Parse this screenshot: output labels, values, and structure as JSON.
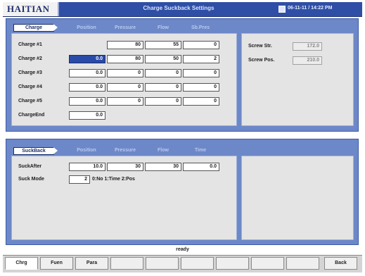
{
  "header": {
    "logo_text": "HAITIAN",
    "title": "Charge Suckback Settings",
    "datetime": "06-11-11 / 14:22 PM"
  },
  "charge": {
    "tab_label": "Charge",
    "columns": [
      "Position",
      "Pressure",
      "Flow",
      "Sb.Pres"
    ],
    "rows": [
      {
        "label": "Charge #1",
        "values": [
          "",
          "80",
          "55",
          "0"
        ]
      },
      {
        "label": "Charge #2",
        "values": [
          "0.0",
          "80",
          "50",
          "2"
        ]
      },
      {
        "label": "Charge #3",
        "values": [
          "0.0",
          "0",
          "0",
          "0"
        ]
      },
      {
        "label": "Charge #4",
        "values": [
          "0.0",
          "0",
          "0",
          "0"
        ]
      },
      {
        "label": "Charge #5",
        "values": [
          "0.0",
          "0",
          "0",
          "0"
        ]
      }
    ],
    "end_label": "ChargeEnd",
    "end_value": "0.0"
  },
  "screw_info": {
    "screw_str_label": "Screw Str.",
    "screw_str_value": "172.0",
    "screw_pos_label": "Screw Pos.",
    "screw_pos_value": "210.0"
  },
  "suckback": {
    "tab_label": "SuckBack",
    "columns": [
      "Position",
      "Pressure",
      "Flow",
      "Time"
    ],
    "after_label": "SuckAfter",
    "after_values": [
      "10.0",
      "30",
      "30",
      "0.0"
    ],
    "mode_label": "Suck Mode",
    "mode_value": "2",
    "mode_hint": "0:No 1:Time 2:Pos"
  },
  "status": {
    "text": "ready"
  },
  "fkeys": {
    "k1": "Chrg",
    "k2": "Fuen",
    "k3": "Para",
    "k4": "",
    "k5": "",
    "k6": "",
    "k7": "",
    "k8": "",
    "k9": "",
    "k10": "Back"
  },
  "colors": {
    "titlebar": "#2f4fa6",
    "panel_frame": "#6d88c8",
    "panel_body": "#e4e4e4",
    "selected_field": "#2a4aa8"
  },
  "icons": {
    "clock": "clock-icon"
  }
}
